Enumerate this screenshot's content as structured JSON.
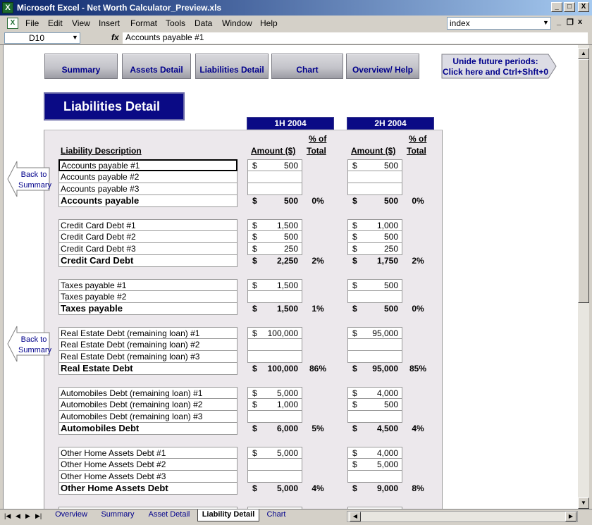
{
  "window": {
    "title": "Microsoft Excel - Net Worth Calculator_Preview.xls",
    "minimize": "_",
    "maximize": "□",
    "close": "X"
  },
  "menu": {
    "items": [
      "File",
      "Edit",
      "View",
      "Insert",
      "Format",
      "Tools",
      "Data",
      "Window",
      "Help"
    ],
    "help_search": "index"
  },
  "formula_bar": {
    "cell_ref": "D10",
    "fx": "fx",
    "content": "Accounts payable #1"
  },
  "nav_buttons": [
    "Summary",
    "Assets Detail",
    "Liabilities Detail",
    "Chart",
    "Overview/ Help"
  ],
  "unhide_button": {
    "line1": "Unide future periods:",
    "line2": "Click here and Ctrl+Shft+0"
  },
  "page_title": "Liabilities Detail",
  "periods": [
    "1H 2004",
    "2H 2004"
  ],
  "columns": {
    "description": "Liability Description",
    "amount": "Amount ($)",
    "pct_line1": "% of",
    "pct_line2": "Total"
  },
  "back_buttons": {
    "line1": "Back to",
    "line2": "Summary"
  },
  "currency_symbol": "$",
  "groups": [
    {
      "items": [
        "Accounts payable #1",
        "Accounts payable #2",
        "Accounts payable #3"
      ],
      "p1": [
        "500",
        "",
        ""
      ],
      "p2": [
        "500",
        "",
        ""
      ],
      "total_label": "Accounts payable",
      "total1": "500",
      "pct1": "0%",
      "total2": "500",
      "pct2": "0%"
    },
    {
      "items": [
        "Credit Card Debt #1",
        "Credit Card Debt #2",
        "Credit Card Debt #3"
      ],
      "p1": [
        "1,500",
        "500",
        "250"
      ],
      "p2": [
        "1,000",
        "500",
        "250"
      ],
      "total_label": "Credit Card Debt",
      "total1": "2,250",
      "pct1": "2%",
      "total2": "1,750",
      "pct2": "2%"
    },
    {
      "items": [
        "Taxes payable #1",
        "Taxes payable #2"
      ],
      "p1": [
        "1,500",
        ""
      ],
      "p2": [
        "500",
        ""
      ],
      "total_label": "Taxes payable",
      "total1": "1,500",
      "pct1": "1%",
      "total2": "500",
      "pct2": "0%"
    },
    {
      "items": [
        "Real Estate Debt (remaining loan) #1",
        "Real Estate Debt (remaining loan) #2",
        "Real Estate Debt (remaining loan) #3"
      ],
      "p1": [
        "100,000",
        "",
        ""
      ],
      "p2": [
        "95,000",
        "",
        ""
      ],
      "total_label": "Real Estate Debt",
      "total1": "100,000",
      "pct1": "86%",
      "total2": "95,000",
      "pct2": "85%"
    },
    {
      "items": [
        "Automobiles Debt (remaining loan) #1",
        "Automobiles Debt (remaining loan) #2",
        "Automobiles Debt (remaining loan) #3"
      ],
      "p1": [
        "5,000",
        "1,000",
        ""
      ],
      "p2": [
        "4,000",
        "500",
        ""
      ],
      "total_label": "Automobiles Debt",
      "total1": "6,000",
      "pct1": "5%",
      "total2": "4,500",
      "pct2": "4%"
    },
    {
      "items": [
        "Other Home Assets Debt #1",
        "Other Home Assets Debt #2",
        "Other Home Assets Debt #3"
      ],
      "p1": [
        "5,000",
        "",
        ""
      ],
      "p2": [
        "4,000",
        "5,000",
        ""
      ],
      "total_label": "Other Home Assets Debt",
      "total1": "5,000",
      "pct1": "4%",
      "total2": "9,000",
      "pct2": "8%"
    }
  ],
  "sheet_tabs": [
    "Overview",
    "Summary",
    "Asset Detail",
    "Liability Detail",
    "Chart"
  ],
  "active_tab": "Liability Detail"
}
